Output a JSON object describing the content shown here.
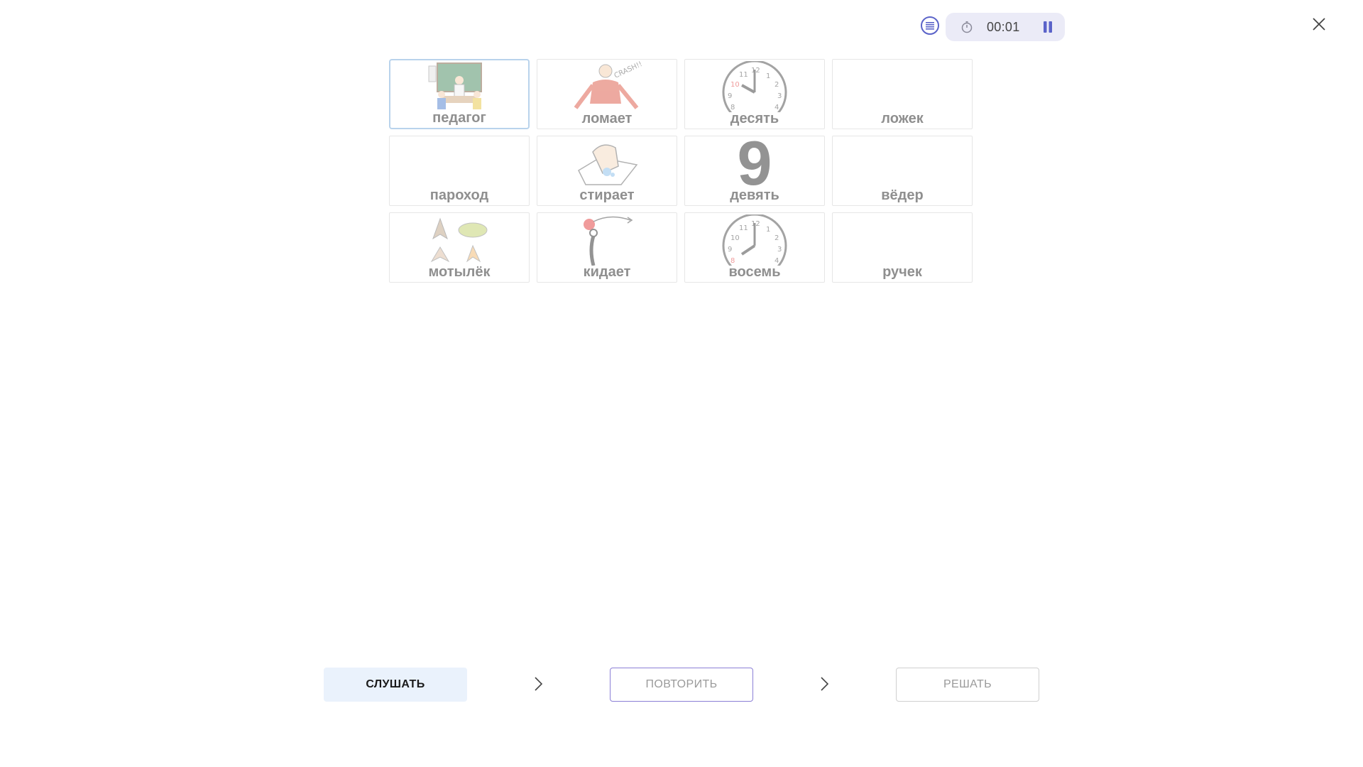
{
  "timer": {
    "time": "00:01"
  },
  "colors": {
    "accent": "#5b63c9",
    "timer_bg": "#ebebf7",
    "listen_bg": "#eaf2fc",
    "repeat_border": "#8b7fd6",
    "selected_border": "#b9d3ec"
  },
  "cards": [
    {
      "word": "педагог",
      "icon": "teacher-classroom-picture",
      "selected": true
    },
    {
      "word": "ломает",
      "icon": "breaking-person-picture"
    },
    {
      "word": "десять",
      "icon": "clock-ten-picture"
    },
    {
      "word": "ложек",
      "icon": ""
    },
    {
      "word": "пароход",
      "icon": ""
    },
    {
      "word": "стирает",
      "icon": "hand-washing-picture"
    },
    {
      "word": "девять",
      "icon": "digit-nine-picture"
    },
    {
      "word": "вёдер",
      "icon": ""
    },
    {
      "word": "мотылёк",
      "icon": "moths-picture"
    },
    {
      "word": "кидает",
      "icon": "throwing-figure-picture"
    },
    {
      "word": "восемь",
      "icon": "clock-eight-picture"
    },
    {
      "word": "ручек",
      "icon": ""
    }
  ],
  "digit_nine": "9",
  "buttons": {
    "listen": "СЛУШАТЬ",
    "repeat": "ПОВТОРИТЬ",
    "solve": "РЕШАТЬ"
  }
}
